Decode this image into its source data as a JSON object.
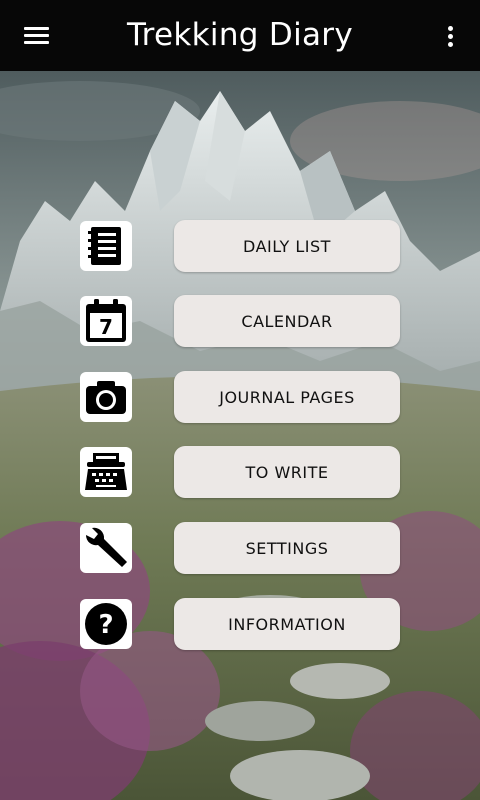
{
  "app": {
    "title": "Trekking Diary"
  },
  "icons": {
    "menu": "hamburger-menu-icon",
    "overflow": "more-vertical-icon"
  },
  "colors": {
    "app_bar": "#070707",
    "button_fill": "#ece8e6",
    "icon_tile": "#ffffff",
    "text_dark": "#111111"
  },
  "menu": [
    {
      "label": "DAILY LIST",
      "icon": "notebook-icon"
    },
    {
      "label": "CALENDAR",
      "icon": "calendar-icon",
      "icon_text": "7"
    },
    {
      "label": "JOURNAL PAGES",
      "icon": "camera-icon"
    },
    {
      "label": "TO WRITE",
      "icon": "typewriter-icon"
    },
    {
      "label": "SETTINGS",
      "icon": "wrench-icon"
    },
    {
      "label": "INFORMATION",
      "icon": "help-icon",
      "icon_text": "?"
    }
  ]
}
